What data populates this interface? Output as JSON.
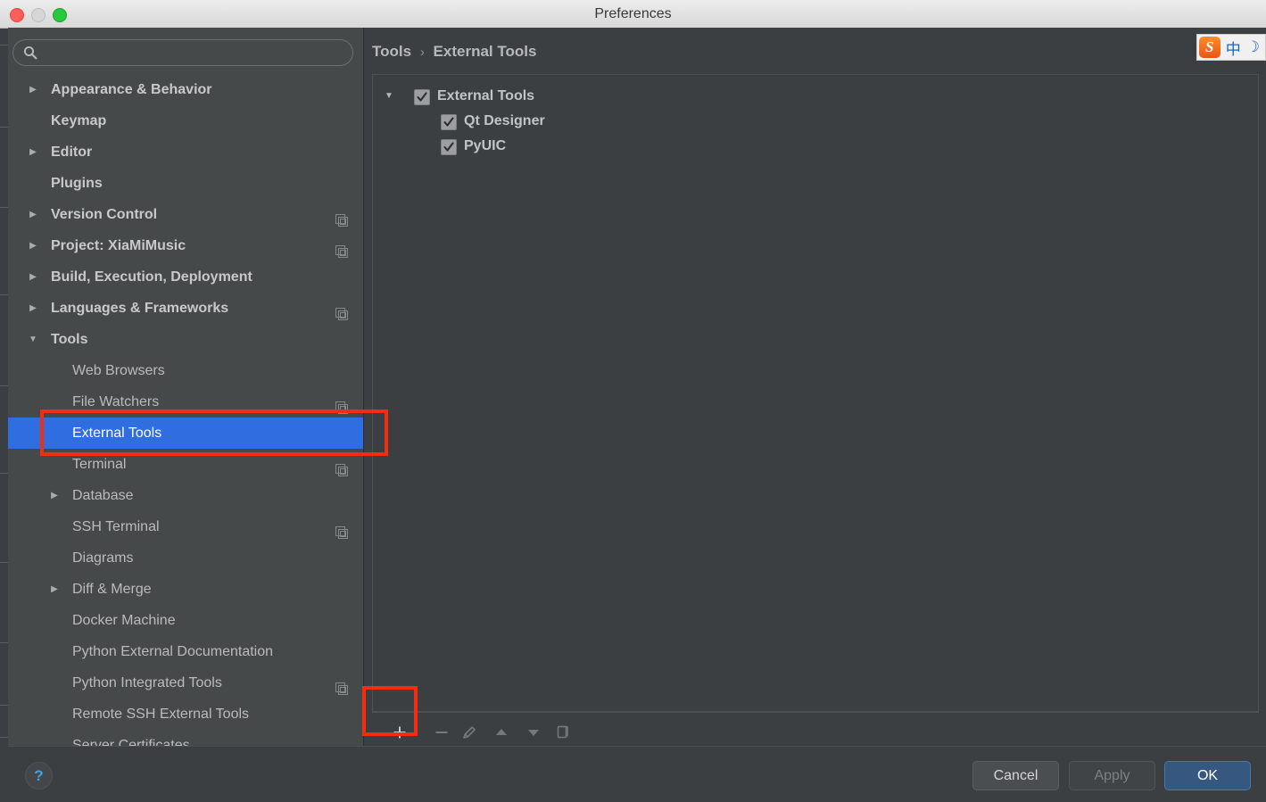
{
  "window": {
    "title": "Preferences",
    "traffic_lights": [
      "close",
      "minimize",
      "zoom"
    ]
  },
  "sidebar": {
    "search": {
      "value": "",
      "placeholder": "",
      "icon": "search-icon"
    },
    "items": [
      {
        "label": "Appearance & Behavior",
        "level": 0,
        "arrow": "collapsed",
        "badge": false,
        "selected": false
      },
      {
        "label": "Keymap",
        "level": 0,
        "arrow": "none",
        "badge": false,
        "selected": false
      },
      {
        "label": "Editor",
        "level": 0,
        "arrow": "collapsed",
        "badge": false,
        "selected": false
      },
      {
        "label": "Plugins",
        "level": 0,
        "arrow": "none",
        "badge": false,
        "selected": false
      },
      {
        "label": "Version Control",
        "level": 0,
        "arrow": "collapsed",
        "badge": true,
        "selected": false
      },
      {
        "label": "Project: XiaMiMusic",
        "level": 0,
        "arrow": "collapsed",
        "badge": true,
        "selected": false
      },
      {
        "label": "Build, Execution, Deployment",
        "level": 0,
        "arrow": "collapsed",
        "badge": false,
        "selected": false
      },
      {
        "label": "Languages & Frameworks",
        "level": 0,
        "arrow": "collapsed",
        "badge": true,
        "selected": false
      },
      {
        "label": "Tools",
        "level": 0,
        "arrow": "expanded",
        "badge": false,
        "selected": false
      },
      {
        "label": "Web Browsers",
        "level": 1,
        "arrow": "none",
        "badge": false,
        "selected": false
      },
      {
        "label": "File Watchers",
        "level": 1,
        "arrow": "none",
        "badge": true,
        "selected": false
      },
      {
        "label": "External Tools",
        "level": 1,
        "arrow": "none",
        "badge": false,
        "selected": true
      },
      {
        "label": "Terminal",
        "level": 1,
        "arrow": "none",
        "badge": true,
        "selected": false
      },
      {
        "label": "Database",
        "level": 1,
        "arrow": "collapsed",
        "badge": false,
        "selected": false
      },
      {
        "label": "SSH Terminal",
        "level": 1,
        "arrow": "none",
        "badge": true,
        "selected": false
      },
      {
        "label": "Diagrams",
        "level": 1,
        "arrow": "none",
        "badge": false,
        "selected": false
      },
      {
        "label": "Diff & Merge",
        "level": 1,
        "arrow": "collapsed",
        "badge": false,
        "selected": false
      },
      {
        "label": "Docker Machine",
        "level": 1,
        "arrow": "none",
        "badge": false,
        "selected": false
      },
      {
        "label": "Python External Documentation",
        "level": 1,
        "arrow": "none",
        "badge": false,
        "selected": false
      },
      {
        "label": "Python Integrated Tools",
        "level": 1,
        "arrow": "none",
        "badge": true,
        "selected": false
      },
      {
        "label": "Remote SSH External Tools",
        "level": 1,
        "arrow": "none",
        "badge": false,
        "selected": false
      },
      {
        "label": "Server Certificates",
        "level": 1,
        "arrow": "none",
        "badge": false,
        "selected": false
      }
    ]
  },
  "content": {
    "breadcrumb": {
      "parent": "Tools",
      "separator": "›",
      "current": "External Tools"
    },
    "tree": [
      {
        "label": "External Tools",
        "level": 0,
        "checked": true,
        "arrow": "expanded"
      },
      {
        "label": "Qt Designer",
        "level": 1,
        "checked": true,
        "arrow": "none"
      },
      {
        "label": "PyUIC",
        "level": 1,
        "checked": true,
        "arrow": "none"
      }
    ],
    "toolbar": [
      {
        "name": "add-button",
        "icon": "plus-icon",
        "enabled": true
      },
      {
        "name": "remove-button",
        "icon": "minus-icon",
        "enabled": false
      },
      {
        "name": "edit-button",
        "icon": "pencil-icon",
        "enabled": false
      },
      {
        "name": "move-up-button",
        "icon": "arrow-up-icon",
        "enabled": false
      },
      {
        "name": "move-down-button",
        "icon": "arrow-down-icon",
        "enabled": false
      },
      {
        "name": "copy-button",
        "icon": "copy-icon",
        "enabled": false
      }
    ]
  },
  "footer": {
    "help_label": "?",
    "cancel_label": "Cancel",
    "apply_label": "Apply",
    "ok_label": "OK"
  },
  "ime": {
    "logo": "S",
    "mode": "中",
    "moon": "☽"
  },
  "annotations": [
    {
      "name": "external-tools-highlight",
      "color": "#f52d10"
    },
    {
      "name": "add-button-highlight",
      "color": "#f52d10"
    }
  ],
  "colors": {
    "selection_blue": "#2f6ee0",
    "ok_blue": "#365880",
    "sidebar_bg": "#45494a",
    "panel_bg": "#3c3f41",
    "annotation_red": "#f52d10"
  }
}
